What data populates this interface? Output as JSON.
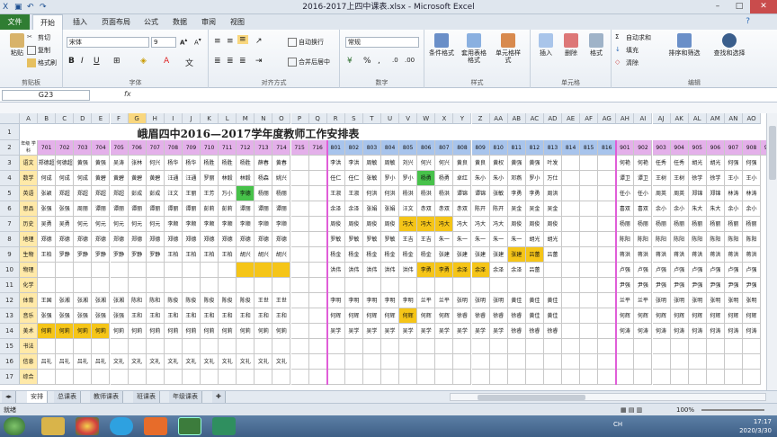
{
  "window": {
    "title": "2016-2017上四中课表.xlsx - Microsoft Excel",
    "min": "–",
    "max": "□",
    "close": "✕"
  },
  "tabs": [
    "文件",
    "开始",
    "插入",
    "页面布局",
    "公式",
    "数据",
    "审阅",
    "视图"
  ],
  "ribbon": {
    "clipboard": {
      "name": "剪贴板",
      "paste": "粘贴",
      "cut": "剪切",
      "copy": "复制",
      "painter": "格式刷"
    },
    "font": {
      "name": "字体",
      "family": "宋体",
      "size": "9",
      "bold": "B",
      "italic": "I",
      "underline": "U"
    },
    "align": {
      "name": "对齐方式",
      "wrap": "自动换行",
      "merge": "合并后居中"
    },
    "number": {
      "name": "数字",
      "format": "常规"
    },
    "styles": {
      "name": "样式",
      "cond": "条件格式",
      "table": "套用表格格式",
      "cell": "单元格样式"
    },
    "cells": {
      "name": "单元格",
      "insert": "插入",
      "delete": "删除",
      "format": "格式"
    },
    "editing": {
      "name": "编辑",
      "autosum": "自动求和",
      "fill": "填充",
      "clear": "清除",
      "sort": "排序和筛选",
      "find": "查找和选择"
    }
  },
  "formula": {
    "namebox": "G23",
    "fx": "fx",
    "content": ""
  },
  "grid": {
    "columns": [
      "A",
      "B",
      "C",
      "D",
      "E",
      "F",
      "G",
      "H",
      "I",
      "J",
      "K",
      "L",
      "M",
      "N",
      "O",
      "P",
      "Q",
      "R",
      "S",
      "T",
      "U",
      "V",
      "W",
      "X",
      "Y",
      "Z",
      "AA",
      "AB",
      "AC",
      "AD",
      "AE",
      "AF",
      "AG",
      "AH",
      "AI",
      "AJ",
      "AK",
      "AL",
      "AM",
      "AN",
      "AO"
    ],
    "selected_col": "G",
    "rows": [
      "1",
      "2",
      "3",
      "4",
      "5",
      "6",
      "7",
      "8",
      "9",
      "10",
      "11",
      "12",
      "13",
      "14",
      "15",
      "16",
      "17"
    ],
    "title": "峨眉四中2016—2017学年度教师工作安排表",
    "corner": "年级 学科",
    "classes": [
      "701",
      "702",
      "703",
      "704",
      "705",
      "706",
      "707",
      "708",
      "709",
      "710",
      "711",
      "712",
      "713",
      "714",
      "715",
      "716",
      "801",
      "802",
      "803",
      "804",
      "805",
      "806",
      "807",
      "808",
      "809",
      "810",
      "811",
      "812",
      "813",
      "814",
      "815",
      "816",
      "901",
      "902",
      "903",
      "904",
      "905",
      "906",
      "907",
      "908",
      "909"
    ],
    "subjects": [
      "语文",
      "数学",
      "英语",
      "思品",
      "历史",
      "地理",
      "生物",
      "物理",
      "化学",
      "体育",
      "音乐",
      "美术",
      "书法",
      "信息",
      "综合"
    ],
    "body": [
      [
        "郑德超",
        "何德超",
        "黄强",
        "黄强",
        "吴涛",
        "张林",
        "何兴",
        "杨华",
        "杨华",
        "杨胜",
        "杨胜",
        "杨胜",
        "薛春",
        "黄春",
        "",
        "",
        "李洪",
        "李洪",
        "周敏",
        "周敏",
        "刘兴",
        "何兴",
        "何兴",
        "黄良",
        "黄良",
        "黄权",
        "黄强",
        "黄强",
        "叶发",
        "",
        "",
        "",
        "何艳",
        "何艳",
        "任秀",
        "任秀",
        "胡光",
        "胡光",
        "何强",
        "何强",
        "何强"
      ],
      [
        "何成",
        "何成",
        "何成",
        "黄碧",
        "黄碧",
        "黄碧",
        "黄碧",
        "汪通",
        "汪通",
        "罗丽",
        "林毅",
        "林毅",
        "杨森",
        "姚兴",
        "",
        "",
        "任仁",
        "任仁",
        "张敏",
        "罗小",
        "罗小",
        "杨勇",
        "杨勇",
        "卓红",
        "朱小",
        "朱小",
        "邓燕",
        "罗小",
        "万仕",
        "",
        "",
        "",
        "谭卫",
        "谭卫",
        "王树",
        "王树",
        "徐学",
        "徐学",
        "王小",
        "王小",
        "王小"
      ],
      [
        "张颖",
        "郑超",
        "郑超",
        "郑超",
        "郑超",
        "彭成",
        "彭成",
        "汪文",
        "王丽",
        "王芳",
        "万小",
        "李德",
        "杨丽",
        "杨丽",
        "",
        "",
        "王淑",
        "王淑",
        "何洪",
        "何洪",
        "杨洪",
        "杨洪",
        "杨洪",
        "谭锦",
        "谭锦",
        "张敏",
        "李勇",
        "李勇",
        "周洪",
        "",
        "",
        "",
        "任小",
        "任小",
        "周英",
        "周英",
        "郑锦",
        "郑锦",
        "林涛",
        "林涛",
        "林涛"
      ],
      [
        "张强",
        "张强",
        "周丽",
        "谭丽",
        "谭丽",
        "谭丽",
        "谭丽",
        "谭丽",
        "谭丽",
        "彭莉",
        "彭莉",
        "谭丽",
        "谭丽",
        "谭丽",
        "",
        "",
        "余泽",
        "余泽",
        "张娟",
        "张娟",
        "汪文",
        "赤双",
        "赤双",
        "赤双",
        "陈开",
        "陈开",
        "吴金",
        "吴金",
        "吴金",
        "",
        "",
        "",
        "喜双",
        "喜双",
        "余小",
        "余小",
        "朱大",
        "朱大",
        "余小",
        "余小",
        "余小"
      ],
      [
        "吴勇",
        "吴勇",
        "何元",
        "何元",
        "何元",
        "何元",
        "何元",
        "李顺",
        "李顺",
        "李顺",
        "李顺",
        "李顺",
        "李顺",
        "李顺",
        "",
        "",
        "周俊",
        "周俊",
        "周俊",
        "周俊",
        "冯大",
        "冯大",
        "冯大",
        "冯大",
        "冯大",
        "冯大",
        "周俊",
        "周俊",
        "周俊",
        "",
        "",
        "",
        "杨丽",
        "杨丽",
        "杨丽",
        "杨丽",
        "杨丽",
        "杨丽",
        "杨丽",
        "杨丽",
        "杨丽"
      ],
      [
        "郑德",
        "郑德",
        "郑德",
        "郑德",
        "郑德",
        "郑德",
        "郑德",
        "郑德",
        "郑德",
        "郑德",
        "郑德",
        "郑德",
        "郑德",
        "郑德",
        "",
        "",
        "罗敏",
        "罗敏",
        "罗敏",
        "罗敏",
        "王吉",
        "王吉",
        "朱一",
        "朱一",
        "朱一",
        "朱一",
        "朱一",
        "胡光",
        "胡光",
        "",
        "",
        "",
        "陈阳",
        "陈阳",
        "陈阳",
        "陈阳",
        "陈阳",
        "陈阳",
        "陈阳",
        "陈阳",
        "陈阳"
      ],
      [
        "王柏",
        "罗静",
        "罗静",
        "罗静",
        "罗静",
        "罗静",
        "罗静",
        "王柏",
        "王柏",
        "王柏",
        "王柏",
        "胡兴",
        "胡兴",
        "胡兴",
        "",
        "",
        "杨金",
        "杨金",
        "杨金",
        "杨金",
        "杨金",
        "杨金",
        "张建",
        "张建",
        "张建",
        "张建",
        "张建",
        "吕蕾",
        "吕蕾",
        "",
        "",
        "",
        "蒋洪",
        "蒋洪",
        "蒋洪",
        "蒋洪",
        "蒋洪",
        "蒋洪",
        "蒋洪",
        "蒋洪",
        "蒋洪"
      ],
      [
        "",
        "",
        "",
        "",
        "",
        "",
        "",
        "",
        "",
        "",
        "",
        "",
        "",
        "",
        "",
        "",
        "洪伟",
        "洪伟",
        "洪伟",
        "洪伟",
        "洪伟",
        "李勇",
        "李勇",
        "余泽",
        "余泽",
        "余泽",
        "余泽",
        "吕蕾",
        "",
        "",
        "",
        "",
        "卢强",
        "卢强",
        "卢强",
        "卢强",
        "卢强",
        "卢强",
        "卢强",
        "卢强",
        "卢强"
      ],
      [
        "",
        "",
        "",
        "",
        "",
        "",
        "",
        "",
        "",
        "",
        "",
        "",
        "",
        "",
        "",
        "",
        "",
        "",
        "",
        "",
        "",
        "",
        "",
        "",
        "",
        "",
        "",
        "",
        "",
        "",
        "",
        "",
        "尹强",
        "尹强",
        "尹强",
        "尹强",
        "尹强",
        "尹强",
        "尹强",
        "尹强",
        "尹强"
      ],
      [
        "王国",
        "张湘",
        "张湘",
        "张湘",
        "张湘",
        "陈和",
        "陈和",
        "陈俊",
        "陈俊",
        "陈俊",
        "陈俊",
        "陈俊",
        "王世",
        "王世",
        "",
        "",
        "李明",
        "李明",
        "李明",
        "李明",
        "李明",
        "兰平",
        "兰平",
        "张明",
        "张明",
        "张明",
        "黄佳",
        "黄佳",
        "黄佳",
        "",
        "",
        "",
        "兰平",
        "兰平",
        "张明",
        "张明",
        "张明",
        "张明",
        "张明",
        "张明",
        "张明"
      ],
      [
        "张强",
        "张强",
        "张强",
        "张强",
        "张强",
        "王和",
        "王和",
        "王和",
        "王和",
        "王和",
        "王和",
        "王和",
        "王和",
        "王和",
        "",
        "",
        "何辉",
        "何辉",
        "何辉",
        "何辉",
        "何辉",
        "何辉",
        "何辉",
        "徐睿",
        "徐睿",
        "徐睿",
        "徐睿",
        "黄佳",
        "黄佳",
        "",
        "",
        "",
        "何辉",
        "何辉",
        "何辉",
        "何辉",
        "何辉",
        "何辉",
        "何辉",
        "何辉",
        "何辉"
      ],
      [
        "何莉",
        "何莉",
        "何莉",
        "何莉",
        "何莉",
        "何莉",
        "何莉",
        "何莉",
        "何莉",
        "何莉",
        "何莉",
        "何莉",
        "何莉",
        "何莉",
        "",
        "",
        "吴学",
        "吴学",
        "吴学",
        "吴学",
        "吴学",
        "吴学",
        "吴学",
        "吴学",
        "吴学",
        "吴学",
        "徐睿",
        "徐睿",
        "徐睿",
        "",
        "",
        "",
        "何涛",
        "何涛",
        "何涛",
        "何涛",
        "何涛",
        "何涛",
        "何涛",
        "何涛",
        "何涛"
      ],
      [
        "",
        "",
        "",
        "",
        "",
        "",
        "",
        "",
        "",
        "",
        "",
        "",
        "",
        "",
        "",
        "",
        "",
        "",
        "",
        "",
        "",
        "",
        "",
        "",
        "",
        "",
        "",
        "",
        "",
        "",
        "",
        "",
        "",
        "",
        "",
        "",
        "",
        "",
        "",
        "",
        ""
      ],
      [
        "吕礼",
        "吕礼",
        "吕礼",
        "吕礼",
        "文礼",
        "文礼",
        "文礼",
        "文礼",
        "文礼",
        "文礼",
        "文礼",
        "文礼",
        "文礼",
        "文礼",
        "",
        "",
        "",
        "",
        "",
        "",
        "",
        "",
        "",
        "",
        "",
        "",
        "",
        "",
        "",
        "",
        "",
        "",
        "",
        "",
        "",
        "",
        "",
        "",
        "",
        "",
        ""
      ],
      [
        "",
        "",
        "",
        "",
        "",
        "",
        "",
        "",
        "",
        "",
        "",
        "",
        "",
        "",
        "",
        "",
        "",
        "",
        "",
        "",
        "",
        "",
        "",
        "",
        "",
        "",
        "",
        "",
        "",
        "",
        "",
        "",
        "",
        "",
        "",
        "",
        "",
        "",
        "",
        "",
        ""
      ]
    ],
    "highlights": [
      {
        "r": 4,
        "c": 12,
        "color": "#47c24a"
      },
      {
        "r": 3,
        "c": 22,
        "color": "#47c24a"
      },
      {
        "r": 6,
        "c": 21,
        "color": "#f5c518"
      },
      {
        "r": 6,
        "c": 22,
        "color": "#f5c518"
      },
      {
        "r": 6,
        "c": 23,
        "color": "#f5c518"
      },
      {
        "r": 8,
        "c": 27,
        "color": "#f5c518"
      },
      {
        "r": 8,
        "c": 28,
        "color": "#f5c518"
      },
      {
        "r": 9,
        "c": 12,
        "color": "#f5c518"
      },
      {
        "r": 9,
        "c": 13,
        "color": "#f5c518"
      },
      {
        "r": 9,
        "c": 14,
        "color": "#f5c518"
      },
      {
        "r": 9,
        "c": 22,
        "color": "#f5c518"
      },
      {
        "r": 9,
        "c": 23,
        "color": "#f5c518"
      },
      {
        "r": 9,
        "c": 24,
        "color": "#f5c518"
      },
      {
        "r": 9,
        "c": 25,
        "color": "#f5c518"
      },
      {
        "r": 12,
        "c": 21,
        "color": "#f5c518"
      },
      {
        "r": 13,
        "c": 1,
        "color": "#f5c518"
      },
      {
        "r": 13,
        "c": 2,
        "color": "#f5c518"
      },
      {
        "r": 13,
        "c": 3,
        "color": "#f5c518"
      },
      {
        "r": 13,
        "c": 4,
        "color": "#f5c518"
      }
    ]
  },
  "sheets": [
    "安排",
    "总课表",
    "教师课表",
    "班课表",
    "年级课表"
  ],
  "status": {
    "left": "就绪",
    "zoom": "100%"
  },
  "clock": {
    "time": "17:17",
    "date": "2020/3/30",
    "lang": "CH"
  }
}
